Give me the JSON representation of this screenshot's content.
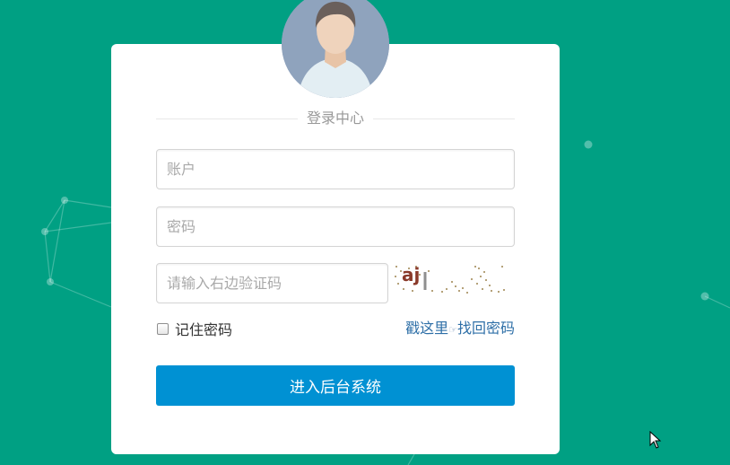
{
  "login": {
    "title": "登录中心",
    "account_placeholder": "账户",
    "password_placeholder": "密码",
    "captcha_placeholder": "请输入右边验证码",
    "captcha_text": "aj",
    "remember_label": "记住密码",
    "forgot_prefix": "戳这里",
    "forgot_hand": "☞",
    "forgot_suffix": "找回密码",
    "submit_label": "进入后台系统"
  },
  "colors": {
    "background": "#00a083",
    "card": "#ffffff",
    "submit": "#0091d3",
    "link": "#2e6fa7",
    "avatar_bg": "#8fa3bd"
  },
  "icons": {
    "avatar": "user-avatar-icon",
    "cursor": "mouse-pointer-icon"
  }
}
